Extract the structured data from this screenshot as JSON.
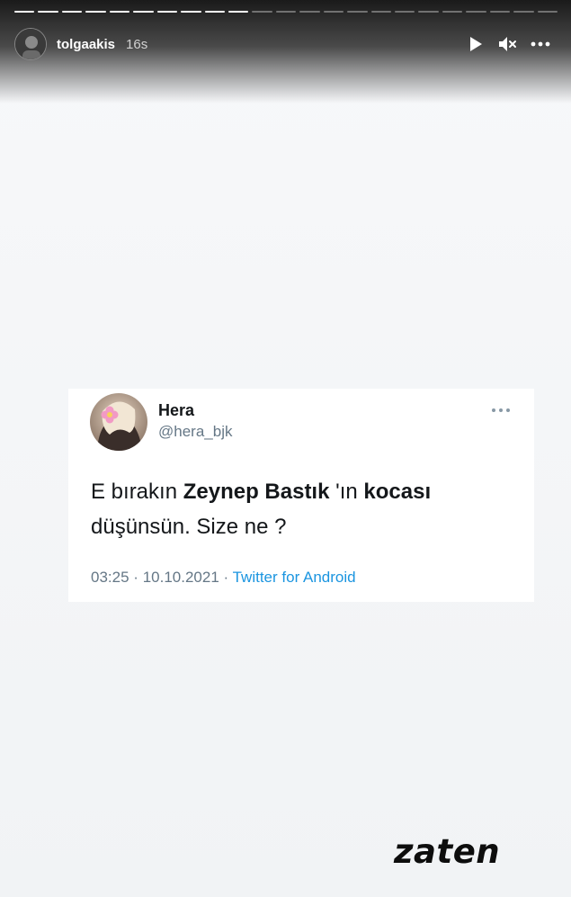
{
  "story": {
    "progress": {
      "total": 23,
      "completed": 10
    },
    "username": "tolgaakis",
    "time_ago": "16s",
    "controls": [
      "play-icon",
      "mute-icon",
      "more-icon"
    ]
  },
  "tweet": {
    "display_name": "Hera",
    "handle": "@hera_bjk",
    "text": {
      "part1": "E bırakın ",
      "bold1": "Zeynep Bastık",
      "part2": " 'ın ",
      "bold2": "kocası",
      "part3": " düşünsün. Size ne ?"
    },
    "time": "03:25",
    "date": "10.10.2021",
    "separator": "·",
    "source": "Twitter for Android"
  },
  "sticker_text": "zaten",
  "colors": {
    "tweet_link": "#1b95e0",
    "tweet_meta": "#657786",
    "background": "#f4f5f7"
  }
}
